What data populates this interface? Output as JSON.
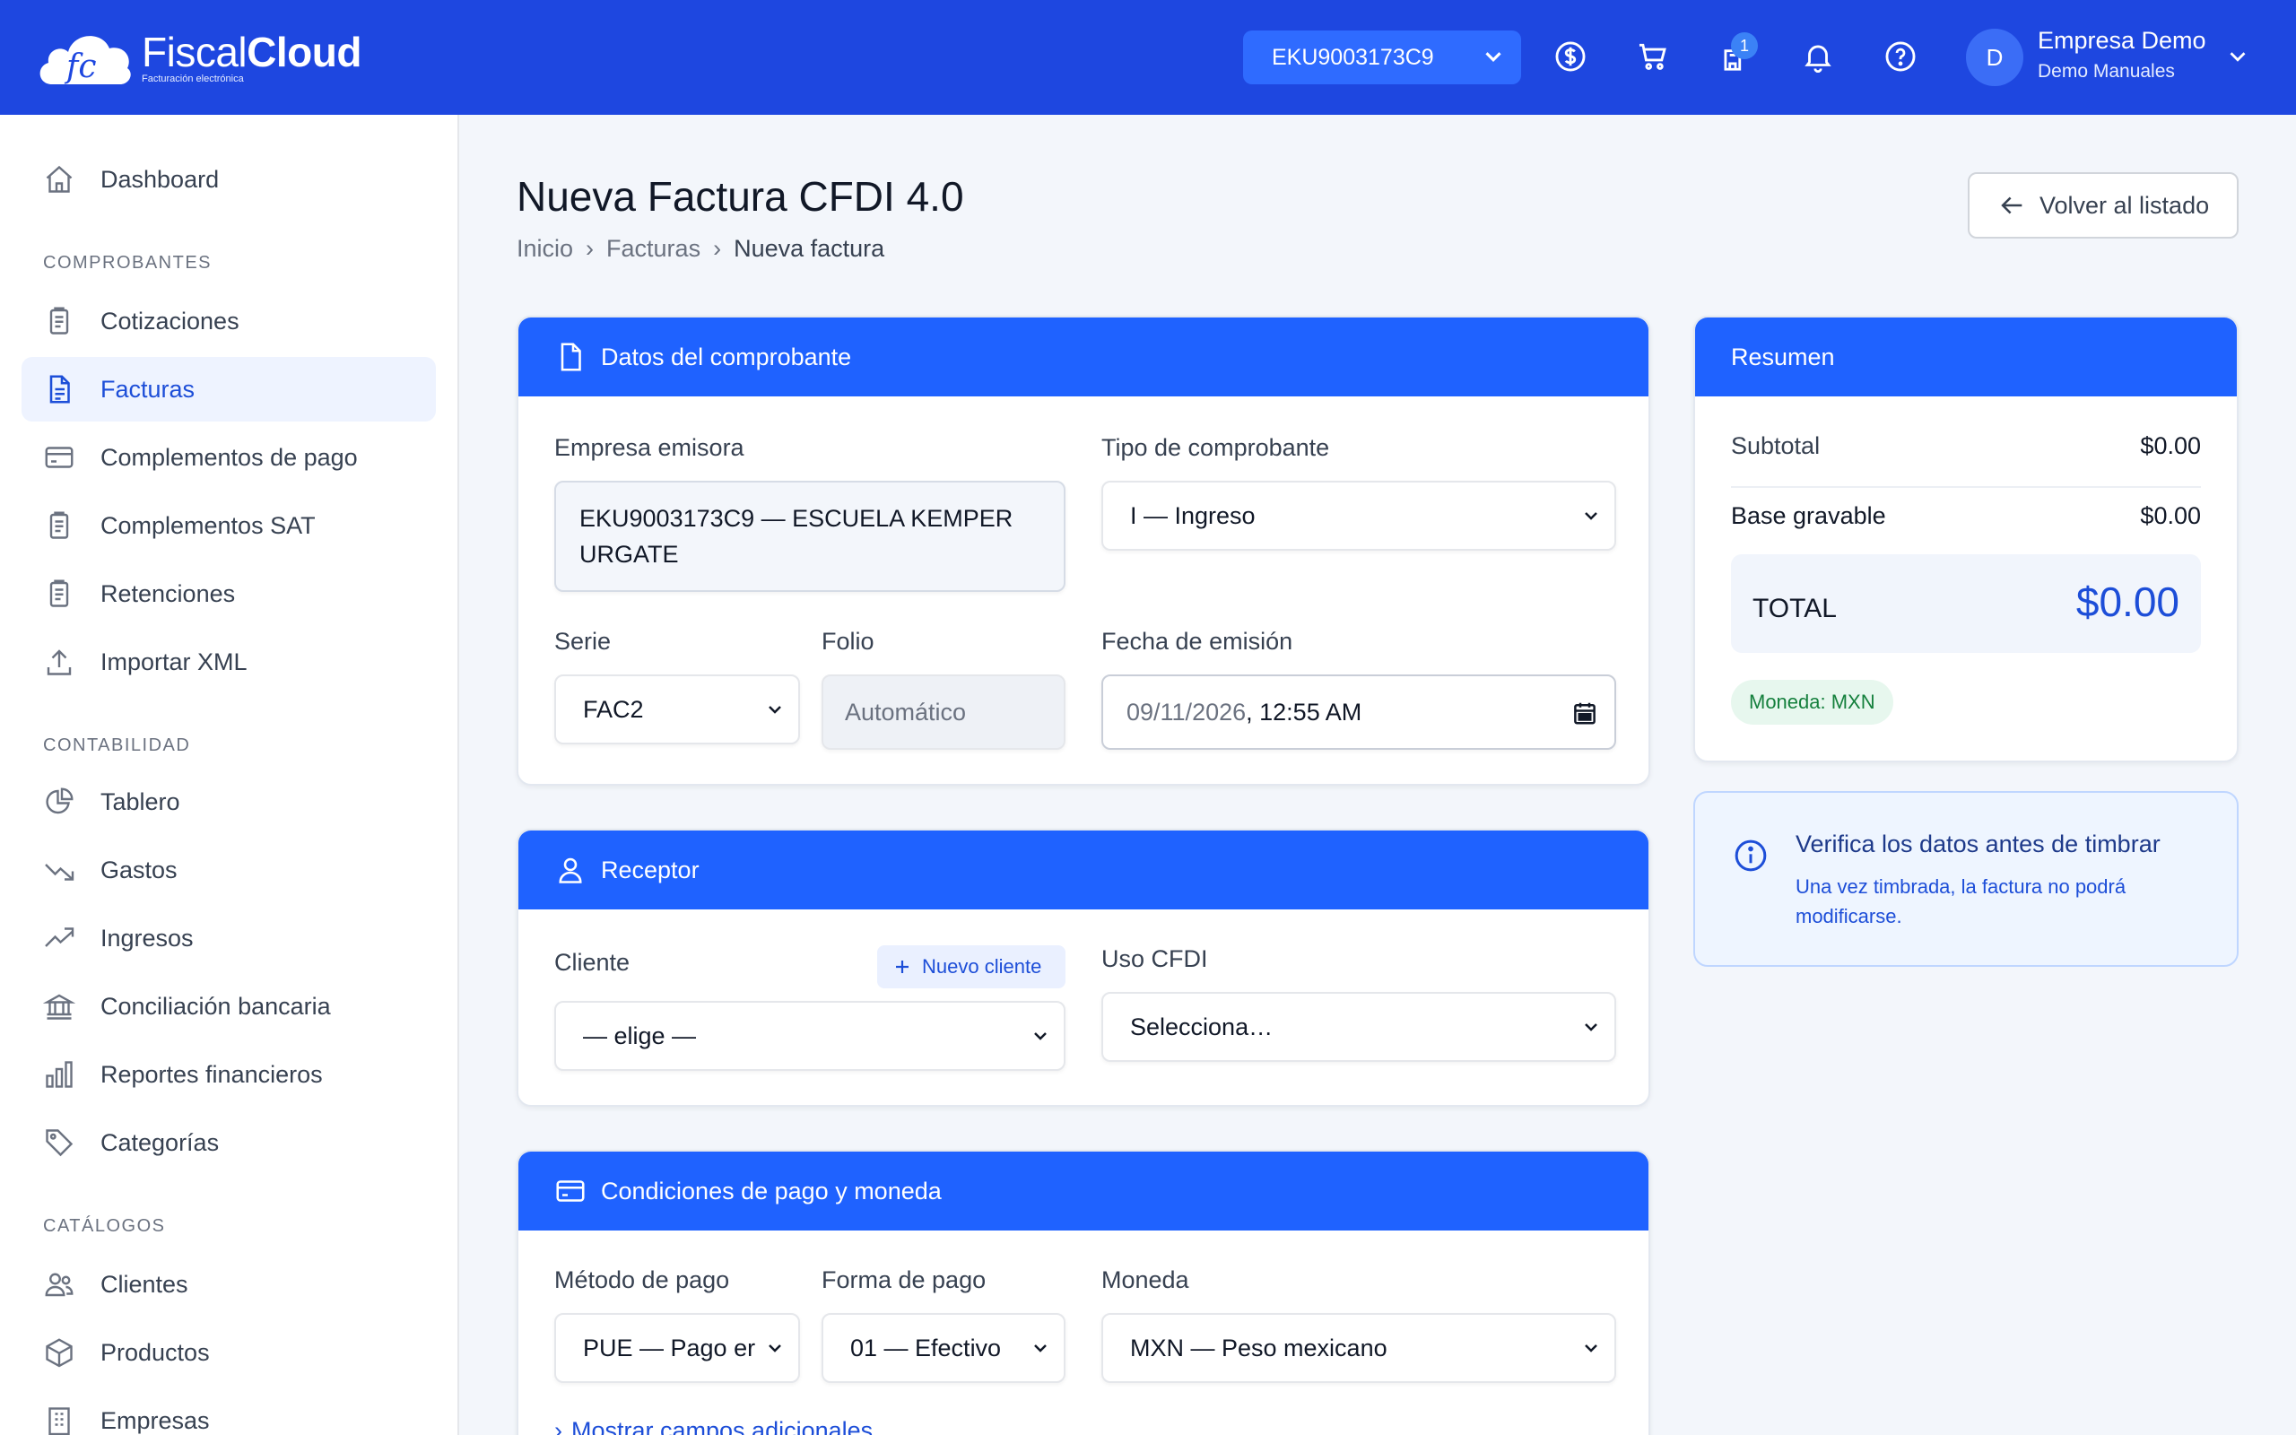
{
  "brand": {
    "name_light": "Fiscal",
    "name_bold": "Cloud",
    "tagline": "Facturación electrónica",
    "logo_mark": "fc"
  },
  "topbar": {
    "org_selector": "EKU9003173C9",
    "icons": [
      "currency-icon",
      "cart-icon",
      "cash-stack-icon",
      "bell-icon",
      "help-icon"
    ],
    "notification_count": "1",
    "user": {
      "initial": "D",
      "name": "Empresa Demo",
      "subtitle": "Demo Manuales"
    }
  },
  "sidebar": {
    "dashboard": "Dashboard",
    "sections": {
      "comprobantes": "COMPROBANTES",
      "contabilidad": "CONTABILIDAD",
      "catalogos": "CATÁLOGOS"
    },
    "items": {
      "cotizaciones": "Cotizaciones",
      "facturas": "Facturas",
      "complementos_pago": "Complementos de pago",
      "complementos_sat": "Complementos SAT",
      "retenciones": "Retenciones",
      "importar_xml": "Importar XML",
      "tablero": "Tablero",
      "gastos": "Gastos",
      "ingresos": "Ingresos",
      "conciliacion": "Conciliación bancaria",
      "reportes": "Reportes financieros",
      "categorias": "Categorías",
      "clientes": "Clientes",
      "productos": "Productos",
      "empresas": "Empresas"
    },
    "active": "facturas"
  },
  "page": {
    "title": "Nueva Factura CFDI 4.0",
    "breadcrumb": [
      "Inicio",
      "Facturas",
      "Nueva factura"
    ],
    "breadcrumb_sep": "›",
    "back_button": "Volver al listado"
  },
  "comprobante": {
    "header": "Datos del comprobante",
    "empresa_label": "Empresa emisora",
    "empresa_line1": "EKU9003173C9 — ESCUELA KEMPER",
    "empresa_line2": "URGATE",
    "tipo_label": "Tipo de comprobante",
    "tipo_value": "I — Ingreso",
    "serie_label": "Serie",
    "serie_value": "FAC2",
    "folio_label": "Folio",
    "folio_placeholder": "Automático",
    "fecha_label": "Fecha de emisión",
    "fecha_date": "09/11/2026",
    "fecha_time": ", 12:55 AM"
  },
  "receptor": {
    "header": "Receptor",
    "cliente_label": "Cliente",
    "nuevo_cliente": "Nuevo cliente",
    "cliente_value": "— elige —",
    "uso_label": "Uso CFDI",
    "uso_value": "Selecciona…"
  },
  "pago": {
    "header": "Condiciones de pago y moneda",
    "metodo_label": "Método de pago",
    "metodo_value": "PUE — Pago er",
    "forma_label": "Forma de pago",
    "forma_value": "01 — Efectivo",
    "moneda_label": "Moneda",
    "moneda_value": "MXN — Peso mexicano",
    "more_link": "Mostrar campos adicionales"
  },
  "resumen": {
    "header": "Resumen",
    "subtotal_label": "Subtotal",
    "subtotal_value": "$0.00",
    "base_label": "Base gravable",
    "base_value": "$0.00",
    "total_label": "TOTAL",
    "total_value": "$0.00",
    "currency_pill": "Moneda: MXN"
  },
  "info": {
    "title": "Verifica los datos antes de timbrar",
    "text": "Una vez timbrada, la factura no podrá modificarse."
  },
  "colors": {
    "primary": "#1f62ff",
    "topbar": "#1e47e0",
    "link": "#1d4ed8",
    "success": "#15803d"
  }
}
